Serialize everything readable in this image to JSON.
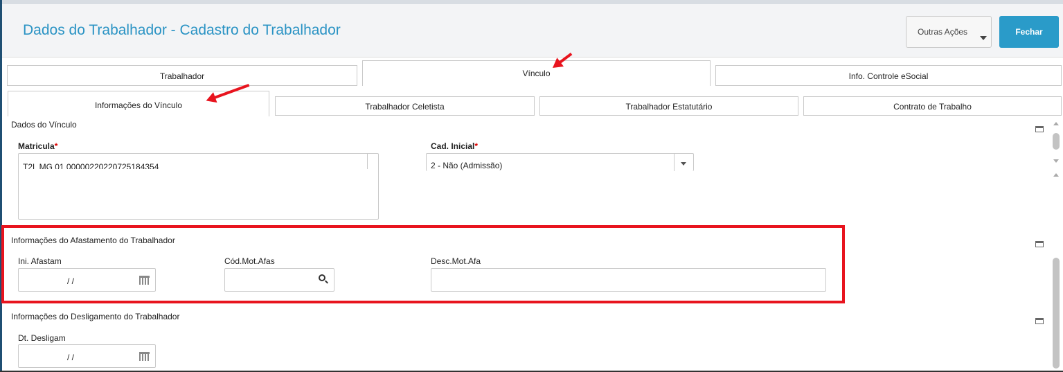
{
  "header": {
    "title": "Dados do Trabalhador - Cadastro do Trabalhador",
    "outras_acoes_label": "Outras Ações",
    "fechar_label": "Fechar"
  },
  "tabs": {
    "main": [
      "Trabalhador",
      "Vínculo",
      "Info. Controle eSocial"
    ],
    "active_main": "Vínculo",
    "sub": [
      "Informações do Vínculo",
      "Trabalhador Celetista",
      "Trabalhador Estatutário",
      "Contrato de Trabalho"
    ],
    "active_sub": "Informações do Vínculo"
  },
  "dados_vinculo": {
    "section_title": "Dados do Vínculo",
    "matricula_label": "Matricula",
    "matricula_value": "T2L MG 01 00000220220725184354",
    "cad_inicial_label": "Cad. Inicial",
    "cad_inicial_value": "2 - Não (Admissão)",
    "required_mark": "*"
  },
  "afastamento": {
    "section_title": "Informações do Afastamento do Trabalhador",
    "ini_afastam_label": "Ini. Afastam",
    "ini_afastam_value": "/ /",
    "cod_mot_label": "Cód.Mot.Afas",
    "cod_mot_value": "",
    "desc_mot_label": "Desc.Mot.Afa",
    "desc_mot_value": ""
  },
  "desligamento": {
    "section_title": "Informações do Desligamento do Trabalhador",
    "dt_desligam_label": "Dt. Desligam",
    "dt_desligam_value": "/ /"
  },
  "colors": {
    "accent": "#2a93c4",
    "button_primary": "#2a9bc9",
    "highlight": "#e8141e"
  }
}
